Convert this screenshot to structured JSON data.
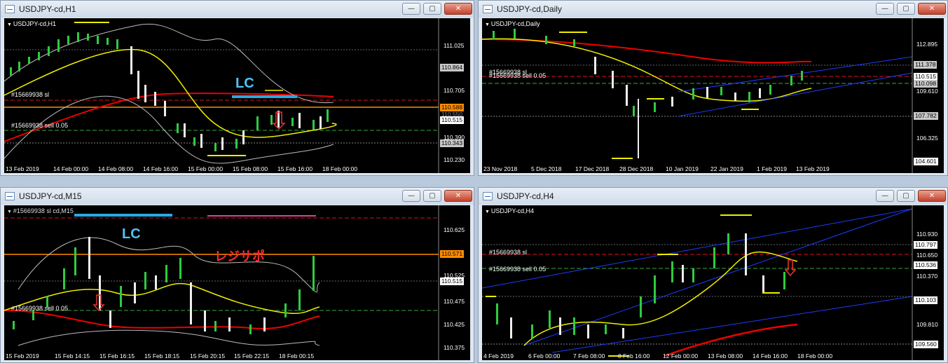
{
  "windows": {
    "h1": {
      "title": "USDJPY-cd,H1",
      "label": "USDJPY-cd,H1",
      "sl_text": "#15669938 sl",
      "sell_text": "#15669938 sell 0.05",
      "lc": "LC",
      "y_ticks": [
        "111.025",
        "110.705",
        "110.390",
        "110.230"
      ],
      "tags": [
        "110.864",
        "110.588",
        "110.550",
        "110.515",
        "110.343"
      ],
      "x_ticks": [
        "13 Feb 2019",
        "14 Feb 00:00",
        "14 Feb 08:00",
        "14 Feb 16:00",
        "15 Feb 00:00",
        "15 Feb 08:00",
        "15 Feb 16:00",
        "18 Feb 00:00"
      ]
    },
    "daily": {
      "title": "USDJPY-cd,Daily",
      "label": "USDJPY-cd,Daily",
      "sl_text": "#15669938 sl",
      "sell_text": "#15669938 sell 0.05",
      "y_ticks": [
        "112.895",
        "111.378",
        "110.515",
        "110.098",
        "109.610",
        "107.782",
        "106.325",
        "104.601"
      ],
      "x_ticks": [
        "23 Nov 2018",
        "5 Dec 2018",
        "17 Dec 2018",
        "28 Dec 2018",
        "10 Jan 2019",
        "22 Jan 2019",
        "1 Feb 2019",
        "13 Feb 2019"
      ]
    },
    "m15": {
      "title": "USDJPY-cd,M15",
      "label": "#15669938 sl cd,M15",
      "sell_text": "#15669938 sell 0.05",
      "lc": "LC",
      "jp": "レジサポ",
      "y_ticks": [
        "110.625",
        "110.571",
        "110.525",
        "110.515",
        "110.475",
        "110.425",
        "110.375"
      ],
      "x_ticks": [
        "15 Feb 2019",
        "15 Feb 14:15",
        "15 Feb 16:15",
        "15 Feb 18:15",
        "15 Feb 20:15",
        "15 Feb 22:15",
        "18 Feb 00:15"
      ]
    },
    "h4": {
      "title": "USDJPY-cd,H4",
      "label": "USDJPY-cd,H4",
      "sl_text": "#15669938 sl",
      "sell_text": "#15669938 sell 0.05",
      "y_ticks": [
        "110.930",
        "110.797",
        "110.650",
        "110.536",
        "110.370",
        "110.103",
        "109.810",
        "109.560"
      ],
      "x_ticks": [
        "4 Feb 2019",
        "6 Feb 00:00",
        "7 Feb 08:00",
        "8 Feb 16:00",
        "12 Feb 00:00",
        "13 Feb 08:00",
        "14 Feb 16:00",
        "18 Feb 00:00"
      ]
    }
  },
  "buttons": {
    "minimize": "—",
    "restore": "▢",
    "close": "✕"
  }
}
